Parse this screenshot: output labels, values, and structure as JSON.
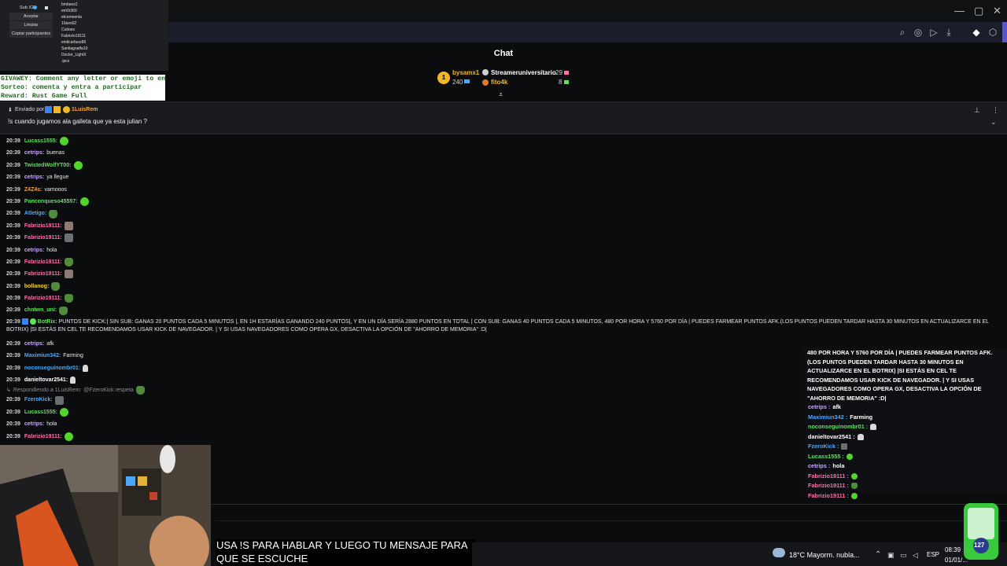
{
  "window": {
    "minimize": "—",
    "maximize": "▢",
    "close": "✕"
  },
  "chat_title": "Chat",
  "leaderboard": [
    {
      "rank": "1",
      "name": "bysamx1",
      "score": "240",
      "name_color": "#f2b724"
    },
    {
      "name": "Streameruniversitario",
      "score": "29",
      "name_color": "#ffffff"
    },
    {
      "name": "fito4k",
      "score": "8",
      "name_color": "#f2b724"
    }
  ],
  "panel": {
    "sub_label": "Sub X2",
    "buttons": [
      "Aceptar",
      "Limpiar",
      "Copiar participantes"
    ],
    "users": [
      "bmbeez2",
      "em0r369",
      "etcomeenla",
      "10asn02",
      "Cutioes",
      "Fabrizio19111",
      "emilcarfaso89",
      "Santiagoalfa10",
      "Doctor_LightX",
      ".ipcs"
    ]
  },
  "giveaway": [
    "GIVAWEY: Comment any letter or emoji to enter",
    "Sorteo: comenta y entra a participar",
    "Reward: Rust Game Full"
  ],
  "pinned": {
    "sent_by_label": "Enviado por",
    "author": "1LuisRem",
    "text": "!s cuando jugamos ala galleta que ya esta julian ?"
  },
  "messages": [
    {
      "time": "20:39",
      "user": "Lucass1555:",
      "color": "#5fe05f",
      "text": "",
      "emote": "blob"
    },
    {
      "time": "20:39",
      "user": "cetrips:",
      "color": "#c9a6ff",
      "text": "buenas",
      "emote": ""
    },
    {
      "time": "20:39",
      "user": "TwistedWolfYT00:",
      "color": "#5fe05f",
      "text": "",
      "emote": "blob"
    },
    {
      "time": "20:39",
      "user": "cetrips:",
      "color": "#c9a6ff",
      "text": "ya llegue",
      "emote": ""
    },
    {
      "time": "20:39",
      "user": "Z4Z4s:",
      "color": "#f4a340",
      "text": "vamooos",
      "emote": ""
    },
    {
      "time": "20:39",
      "user": "Panconqueso45557:",
      "color": "#5fe05f",
      "text": "",
      "emote": "blob"
    },
    {
      "time": "20:39",
      "user": "Atletigo:",
      "color": "#4aa8ff",
      "text": "",
      "emote": "frog"
    },
    {
      "time": "20:39",
      "user": "Fabrizio19111:",
      "color": "#ff6fa8",
      "text": "",
      "emote": "dog"
    },
    {
      "time": "20:39",
      "user": "Fabrizio19111:",
      "color": "#ff6fa8",
      "text": "",
      "emote": "cat"
    },
    {
      "time": "20:39",
      "user": "cetrips:",
      "color": "#c9a6ff",
      "text": "hola",
      "emote": ""
    },
    {
      "time": "20:39",
      "user": "Fabrizio19111:",
      "color": "#ff6fa8",
      "text": "",
      "emote": "frog"
    },
    {
      "time": "20:39",
      "user": "Fabrizio19111:",
      "color": "#ff6fa8",
      "text": "",
      "emote": "dog"
    },
    {
      "time": "20:39",
      "user": "bollanog:",
      "color": "#f2d23c",
      "text": "",
      "emote": "frog"
    },
    {
      "time": "20:39",
      "user": "Fabrizio19111:",
      "color": "#ff6fa8",
      "text": "",
      "emote": "frog"
    },
    {
      "time": "20:39",
      "user": "chntwn_uni:",
      "color": "#5fe05f",
      "text": "",
      "emote": "frog"
    }
  ],
  "botrix": {
    "time": "20:39",
    "user": "BotRix:",
    "text": "PUNTOS DE KICK:| SIN SUB: GANAS 20 PUNTOS CADA 5 MINUTOS |, EN 1H ESTARÍAS GANANDO 240 PUNTOS|, Y EN UN DÍA SERÍA 2880 PUNTOS EN TOTAL | CON SUB: GANAS 40 PUNTOS CADA 5 MINUTOS, 480 POR HORA Y 5760 POR DÍA | PUEDES FARMEAR PUNTOS AFK.(LOS PUNTOS PUEDEN TARDAR HASTA 30 MINUTOS EN ACTUALIZARCE EN EL BOTRIX) |SI ESTÁS EN CEL TE RECOMENDAMOS USAR KICK DE NAVEGADOR. | Y SI USAS NAVEGADORES COMO OPERA GX, DESACTIVA LA OPCIÓN DE \"AHORRO DE MEMORIA\" :D|"
  },
  "messages2": [
    {
      "time": "20:39",
      "user": "cetrips:",
      "color": "#c9a6ff",
      "text": "afk",
      "emote": ""
    },
    {
      "time": "20:39",
      "user": "Maximiun342:",
      "color": "#4aa8ff",
      "text": "Farming",
      "emote": ""
    },
    {
      "time": "20:39",
      "user": "noconseguinombr01:",
      "color": "#4aa8ff",
      "text": "",
      "emote": "hand"
    },
    {
      "time": "20:39",
      "user": "danieltovar2541:",
      "color": "#ffffff",
      "text": "",
      "emote": "hand"
    }
  ],
  "reply": {
    "label": "Respondiendo a 1LuisRem:",
    "quote": "@FzeroKick respeta"
  },
  "messages3": [
    {
      "time": "20:39",
      "user": "FzeroKick:",
      "color": "#4aa8ff",
      "text": "",
      "emote": "cat"
    },
    {
      "time": "20:39",
      "user": "Lucass1555:",
      "color": "#5fe05f",
      "text": "",
      "emote": "blob"
    },
    {
      "time": "20:39",
      "user": "cetrips:",
      "color": "#c9a6ff",
      "text": "hola",
      "emote": ""
    },
    {
      "time": "20:39",
      "user": "Fabrizio19111:",
      "color": "#ff6fa8",
      "text": "",
      "emote": "blob"
    }
  ],
  "overlay": {
    "paragraph": "480 POR HORA Y 5760 POR DÍA | PUEDES FARMEAR PUNTOS AFK.(LOS PUNTOS PUEDEN TARDAR HASTA 30 MINUTOS EN ACTUALIZARCE EN EL BOTRIX) |SI ESTÁS EN CEL TE RECOMENDAMOS USAR KICK DE NAVEGADOR. | Y SI USAS NAVEGADORES COMO OPERA GX, DESACTIVA LA OPCIÓN DE \"AHORRO DE MEMORIA\" :D|",
    "lines": [
      {
        "user": "cetrips :",
        "color": "#c9a6ff",
        "text": "afk",
        "emote": ""
      },
      {
        "user": "Maximiun342 :",
        "color": "#4aa8ff",
        "text": "Farming",
        "emote": ""
      },
      {
        "user": "noconseguinombr01 :",
        "color": "#5fe05f",
        "text": "",
        "emote": "hand"
      },
      {
        "user": "danieltovar2541 :",
        "color": "#ffffff",
        "text": "",
        "emote": "hand"
      },
      {
        "user": "FzeroKick :",
        "color": "#4aa8ff",
        "text": "",
        "emote": "cat"
      },
      {
        "user": "Lucass1555 :",
        "color": "#5fe05f",
        "text": "",
        "emote": "blob"
      },
      {
        "user": "cetrips :",
        "color": "#c9a6ff",
        "text": "hola",
        "emote": ""
      },
      {
        "user": "Fabrizio19111 :",
        "color": "#ff6fa8",
        "text": "",
        "emote": "blob"
      },
      {
        "user": "Fabrizio19111 :",
        "color": "#ff6fa8",
        "text": "",
        "emote": "frog"
      },
      {
        "user": "Fabrizio19111 :",
        "color": "#ff6fa8",
        "text": "",
        "emote": "blob"
      }
    ]
  },
  "caption": "USA !S PARA HABLAR Y LUEGO TU MENSAJE PARA QUE SE ESCUCHE",
  "taskbar": {
    "weather": "18°C  Mayorm. nubla...",
    "lang": "ESP",
    "time": "08:39",
    "date": "01/01/..."
  },
  "badge_count": "127"
}
